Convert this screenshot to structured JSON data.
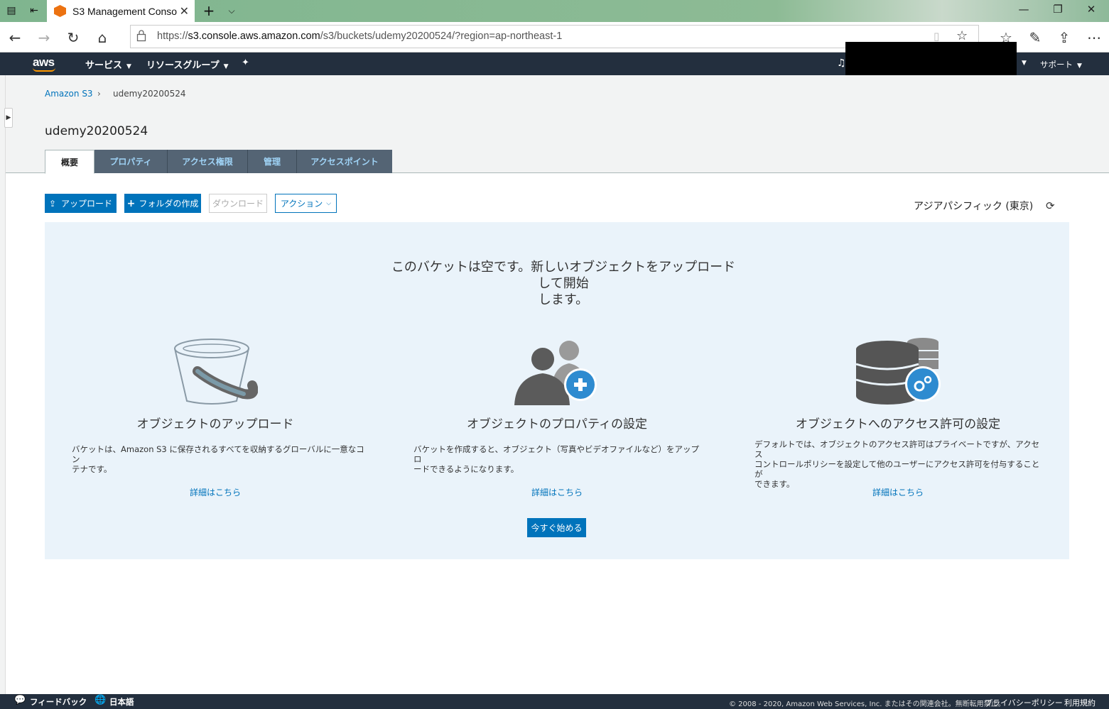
{
  "browser": {
    "tab_title": "S3 Management Conso",
    "url_prefix": "https://",
    "url_host": "s3.console.aws.amazon.com",
    "url_path": "/s3/buckets/udemy20200524/?region=ap-northeast-1"
  },
  "header": {
    "logo": "aws",
    "services": "サービス",
    "resource_groups": "リソースグループ",
    "support": "サポート"
  },
  "breadcrumb": {
    "root": "Amazon S3",
    "current": "udemy20200524"
  },
  "bucket_title": "udemy20200524",
  "tabs": [
    {
      "label": "概要",
      "active": true
    },
    {
      "label": "プロパティ"
    },
    {
      "label": "アクセス権限"
    },
    {
      "label": "管理"
    },
    {
      "label": "アクセスポイント"
    }
  ],
  "toolbar": {
    "upload": "アップロード",
    "create_folder": "フォルダの作成",
    "download": "ダウンロード",
    "actions": "アクション",
    "region": "アジアパシフィック (東京)"
  },
  "empty_state": {
    "headline_1": "このバケットは空です。新しいオブジェクトをアップロードして開始",
    "headline_2": "します。",
    "cards": [
      {
        "title": "オブジェクトのアップロード",
        "desc_1": "バケットは、Amazon S3 に保存されるすべてを収納するグローバルに一意なコン",
        "desc_2": "テナです。",
        "desc_3": "",
        "link": "詳細はこちら"
      },
      {
        "title": "オブジェクトのプロパティの設定",
        "desc_1": "バケットを作成すると、オブジェクト（写真やビデオファイルなど）をアップロ",
        "desc_2": "ードできるようになります。",
        "desc_3": "",
        "link": "詳細はこちら"
      },
      {
        "title": "オブジェクトへのアクセス許可の設定",
        "desc_1": "デフォルトでは、オブジェクトのアクセス許可はプライベートですが、アクセス",
        "desc_2": "コントロールポリシーを設定して他のユーザーにアクセス許可を付与することが",
        "desc_3": "できます。",
        "link": "詳細はこちら"
      }
    ],
    "start_button": "今すぐ始める"
  },
  "footer": {
    "feedback": "フィードバック",
    "language": "日本語",
    "copyright": "© 2008 - 2020, Amazon Web Services, Inc. またはその関連会社。無断転用禁止。",
    "privacy": "プライバシーポリシー",
    "terms": "利用規約"
  },
  "colors": {
    "aws_navy": "#232f3e",
    "primary_blue": "#0073bb",
    "panel_bg": "#eaf3fa",
    "tab_bg": "#546474"
  }
}
